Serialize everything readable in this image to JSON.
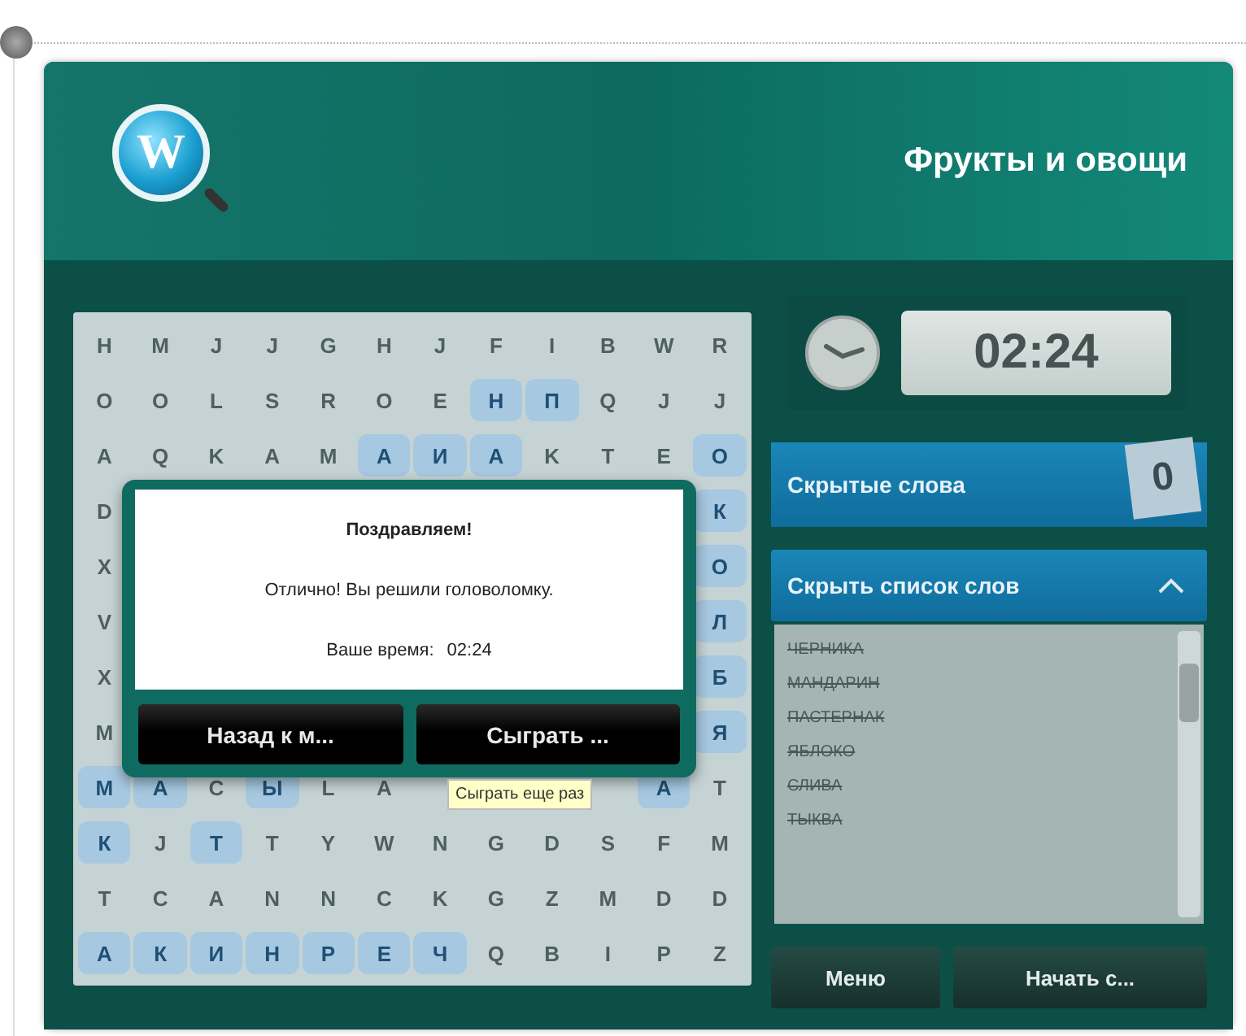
{
  "header": {
    "logo_letter": "W",
    "title": "Фрукты и овощи"
  },
  "grid": {
    "rows": [
      {
        "kind": "full",
        "cells": [
          {
            "letter": "H",
            "found": false
          },
          {
            "letter": "M",
            "found": false
          },
          {
            "letter": "J",
            "found": false
          },
          {
            "letter": "J",
            "found": false
          },
          {
            "letter": "G",
            "found": false
          },
          {
            "letter": "H",
            "found": false
          },
          {
            "letter": "J",
            "found": false
          },
          {
            "letter": "F",
            "found": false
          },
          {
            "letter": "I",
            "found": false
          },
          {
            "letter": "B",
            "found": false
          },
          {
            "letter": "W",
            "found": false
          },
          {
            "letter": "R",
            "found": false
          }
        ]
      },
      {
        "kind": "full",
        "cells": [
          {
            "letter": "O",
            "found": false
          },
          {
            "letter": "O",
            "found": false
          },
          {
            "letter": "L",
            "found": false
          },
          {
            "letter": "S",
            "found": false
          },
          {
            "letter": "R",
            "found": false
          },
          {
            "letter": "O",
            "found": false
          },
          {
            "letter": "E",
            "found": false
          },
          {
            "letter": "Н",
            "found": true
          },
          {
            "letter": "П",
            "found": true
          },
          {
            "letter": "Q",
            "found": false
          },
          {
            "letter": "J",
            "found": false
          },
          {
            "letter": "J",
            "found": false
          }
        ]
      },
      {
        "kind": "full",
        "cells": [
          {
            "letter": "A",
            "found": false
          },
          {
            "letter": "Q",
            "found": false
          },
          {
            "letter": "K",
            "found": false
          },
          {
            "letter": "A",
            "found": false
          },
          {
            "letter": "M",
            "found": false
          },
          {
            "letter": "А",
            "found": true
          },
          {
            "letter": "И",
            "found": true
          },
          {
            "letter": "А",
            "found": true
          },
          {
            "letter": "K",
            "found": false
          },
          {
            "letter": "T",
            "found": false
          },
          {
            "letter": "E",
            "found": false
          },
          {
            "letter": "О",
            "found": true
          }
        ]
      },
      {
        "kind": "split",
        "left": [
          {
            "letter": "D",
            "found": false
          }
        ],
        "right": [
          {
            "letter": "К",
            "found": true
          }
        ]
      },
      {
        "kind": "split",
        "left": [
          {
            "letter": "X",
            "found": false
          }
        ],
        "right": [
          {
            "letter": "О",
            "found": true
          }
        ]
      },
      {
        "kind": "split",
        "left": [
          {
            "letter": "V",
            "found": false
          }
        ],
        "right": [
          {
            "letter": "Л",
            "found": true
          }
        ]
      },
      {
        "kind": "split",
        "left": [
          {
            "letter": "X",
            "found": false
          }
        ],
        "right": [
          {
            "letter": "Б",
            "found": true
          }
        ]
      },
      {
        "kind": "split",
        "left": [
          {
            "letter": "M",
            "found": false
          }
        ],
        "right": [
          {
            "letter": "Я",
            "found": true
          }
        ]
      },
      {
        "kind": "split",
        "left": [
          {
            "letter": "М",
            "found": true
          },
          {
            "letter": "А",
            "found": true
          },
          {
            "letter": "С",
            "found": false
          },
          {
            "letter": "Ы",
            "found": true
          },
          {
            "letter": "L",
            "found": false
          },
          {
            "letter": "А",
            "found": false
          }
        ],
        "right": [
          {
            "letter": "А",
            "found": true
          },
          {
            "letter": "T",
            "found": false
          }
        ]
      },
      {
        "kind": "full",
        "cells": [
          {
            "letter": "К",
            "found": true
          },
          {
            "letter": "J",
            "found": false
          },
          {
            "letter": "Т",
            "found": true
          },
          {
            "letter": "T",
            "found": false
          },
          {
            "letter": "Y",
            "found": false
          },
          {
            "letter": "W",
            "found": false
          },
          {
            "letter": "N",
            "found": false
          },
          {
            "letter": "G",
            "found": false
          },
          {
            "letter": "D",
            "found": false
          },
          {
            "letter": "S",
            "found": false
          },
          {
            "letter": "F",
            "found": false
          },
          {
            "letter": "M",
            "found": false
          }
        ]
      },
      {
        "kind": "full",
        "cells": [
          {
            "letter": "T",
            "found": false
          },
          {
            "letter": "C",
            "found": false
          },
          {
            "letter": "A",
            "found": false
          },
          {
            "letter": "N",
            "found": false
          },
          {
            "letter": "N",
            "found": false
          },
          {
            "letter": "C",
            "found": false
          },
          {
            "letter": "K",
            "found": false
          },
          {
            "letter": "G",
            "found": false
          },
          {
            "letter": "Z",
            "found": false
          },
          {
            "letter": "M",
            "found": false
          },
          {
            "letter": "D",
            "found": false
          },
          {
            "letter": "D",
            "found": false
          }
        ]
      },
      {
        "kind": "full",
        "cells": [
          {
            "letter": "А",
            "found": true
          },
          {
            "letter": "К",
            "found": true
          },
          {
            "letter": "И",
            "found": true
          },
          {
            "letter": "Н",
            "found": true
          },
          {
            "letter": "Р",
            "found": true
          },
          {
            "letter": "Е",
            "found": true
          },
          {
            "letter": "Ч",
            "found": true
          },
          {
            "letter": "Q",
            "found": false
          },
          {
            "letter": "B",
            "found": false
          },
          {
            "letter": "I",
            "found": false
          },
          {
            "letter": "P",
            "found": false
          },
          {
            "letter": "Z",
            "found": false
          }
        ]
      }
    ]
  },
  "dialog": {
    "title": "Поздравляем!",
    "message": "Отлично! Вы решили головоломку.",
    "time_label": "Ваше время:",
    "time_value": "02:24",
    "buttons": [
      "Назад к м...",
      "Сыграть ..."
    ],
    "tooltip": "Сыграть еще раз"
  },
  "timer": "02:24",
  "hidden_words": {
    "label": "Скрытые слова",
    "count": "0"
  },
  "word_list": {
    "toggle_label": "Скрыть список слов",
    "expanded": true,
    "words": [
      {
        "text": "ЧЕРНИКА",
        "found": true
      },
      {
        "text": "МАНДАРИН",
        "found": true
      },
      {
        "text": "ПАСТЕРНАК",
        "found": true
      },
      {
        "text": "ЯБЛОКО",
        "found": true
      },
      {
        "text": "СЛИВА",
        "found": true
      },
      {
        "text": "ТЫКВА",
        "found": true
      }
    ]
  },
  "buttons": [
    "Меню",
    "Начать с..."
  ]
}
